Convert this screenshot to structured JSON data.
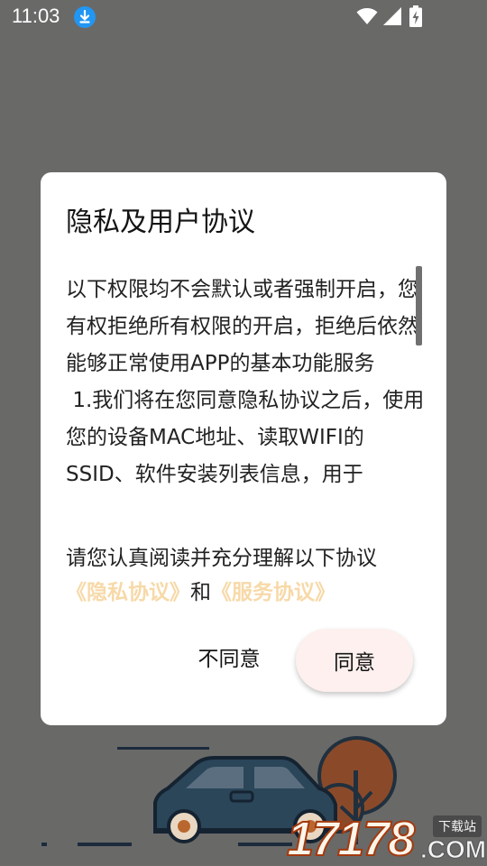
{
  "status_bar": {
    "time": "11:03",
    "icons": [
      "download-icon",
      "wifi-icon",
      "cell-signal-icon",
      "battery-charging-icon"
    ]
  },
  "dialog": {
    "title": "隐私及用户协议",
    "body": "以下权限均不会默认或者强制开启，您有权拒绝所有权限的开启，拒绝后依然能够正常使用APP的基本功能服务\n 1.我们将在您同意隐私协议之后，使用您的设备MAC地址、读取WIFI的SSID、软件安装列表信息，用于",
    "agree_prompt": "请您认真阅读并充分理解以下协议",
    "privacy_link": "《隐私协议》",
    "and_text": "和",
    "service_link": "《服务协议》",
    "disagree_label": "不同意",
    "agree_label": "同意"
  },
  "watermark": {
    "digits": "17178",
    "tag": "下载站",
    "suffix": ".COM"
  },
  "colors": {
    "overlay": "#696968",
    "link": "#f7d9a8",
    "agree_button": "#fdf0ee",
    "download_badge": "#2196f3"
  }
}
